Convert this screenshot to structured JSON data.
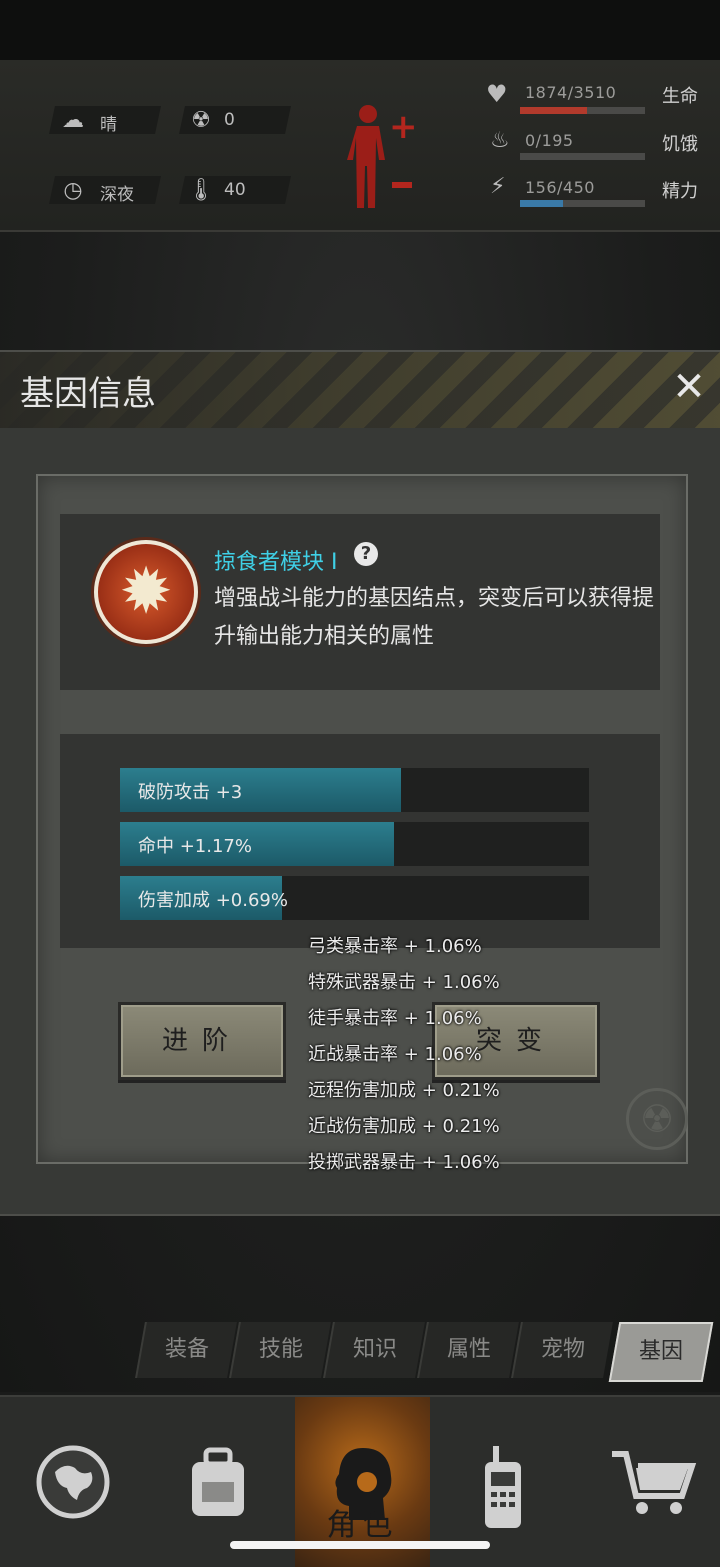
{
  "status": {
    "weather": {
      "icon": "cloud-sun-icon",
      "label": "晴"
    },
    "radiation": {
      "icon": "radiation-icon",
      "value": "0"
    },
    "time": {
      "icon": "clock-icon",
      "label": "深夜"
    },
    "temperature": {
      "icon": "thermometer-icon",
      "value": "40"
    },
    "body_icon": "body-figure-icon",
    "life": {
      "icon": "heart-icon",
      "text": "1874/3510",
      "label": "生命",
      "fraction": 0.534,
      "color": "#b23a2c"
    },
    "hunger": {
      "icon": "stomach-icon",
      "text": "0/195",
      "label": "饥饿",
      "fraction": 0.0,
      "color": "#8a8a86"
    },
    "energy": {
      "icon": "energy-head-icon",
      "text": "156/450",
      "label": "精力",
      "fraction": 0.347,
      "color": "#3a7aa8"
    }
  },
  "dialog": {
    "title": "基因信息",
    "close_icon": "close-icon",
    "gene": {
      "icon": "spiked-gene-icon",
      "name": "掠食者模块 I",
      "help_icon": "question-icon",
      "description": "增强战斗能力的基因结点，突变后可以获得提升输出能力相关的属性"
    },
    "stats": [
      {
        "label": "破防攻击 +3",
        "fraction": 0.6
      },
      {
        "label": "命中 +1.17%",
        "fraction": 0.585
      },
      {
        "label": "伤害加成 +0.69%",
        "fraction": 0.345
      }
    ],
    "buttons": {
      "advance": "进阶",
      "mutate": "突变"
    },
    "tooltip": [
      "弓类暴击率 + 1.06%",
      "特殊武器暴击 + 1.06%",
      "徒手暴击率 + 1.06%",
      "近战暴击率 + 1.06%",
      "远程伤害加成 + 0.21%",
      "近战伤害加成 + 0.21%",
      "投掷武器暴击 + 1.06%"
    ]
  },
  "subtabs": [
    "装备",
    "技能",
    "知识",
    "属性",
    "宠物",
    "基因"
  ],
  "active_subtab": "基因",
  "bottom_nav": {
    "items": [
      {
        "icon": "globe-icon"
      },
      {
        "icon": "backpack-icon"
      },
      {
        "icon": "character-head-icon",
        "label": "角色"
      },
      {
        "icon": "radio-icon"
      },
      {
        "icon": "shopping-cart-icon"
      }
    ]
  }
}
